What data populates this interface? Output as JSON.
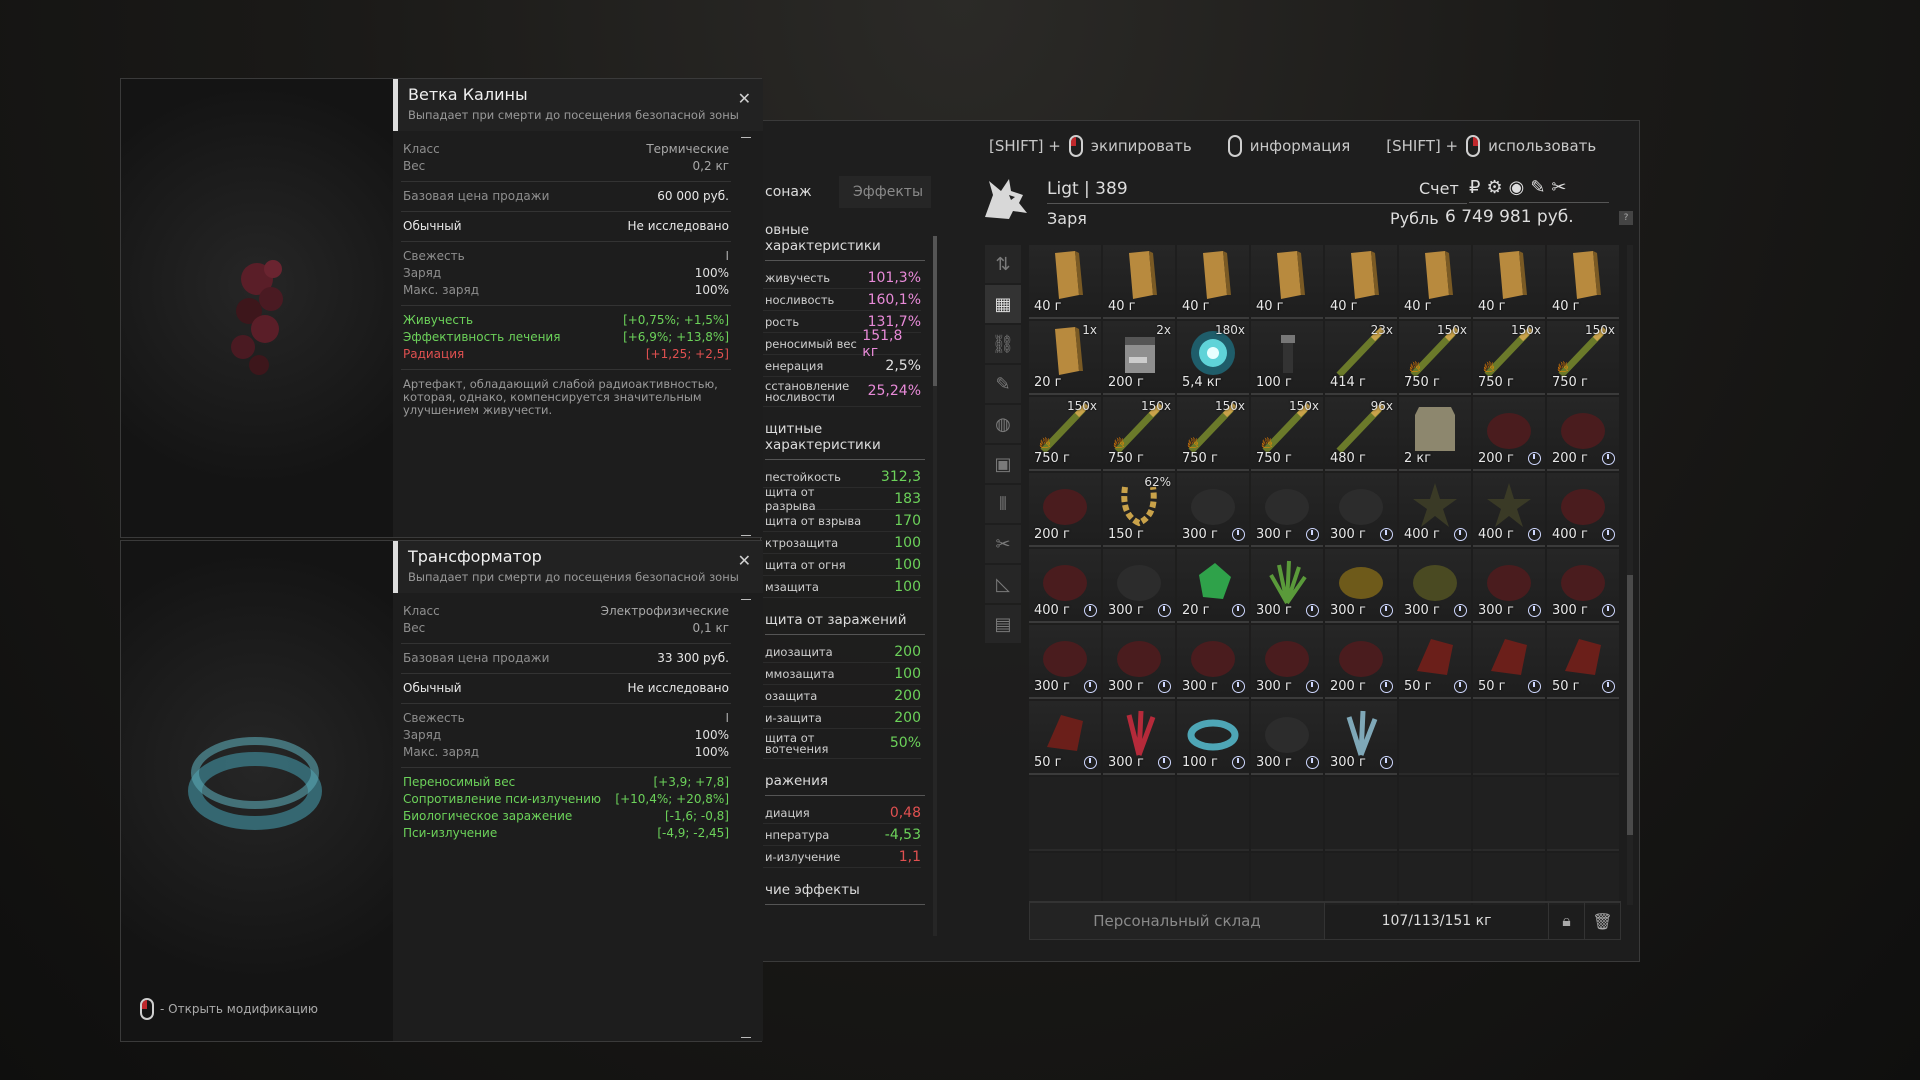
{
  "hints": {
    "equip_prefix": "[SHIFT] +",
    "equip_label": "экипировать",
    "info_label": "информация",
    "use_prefix": "[SHIFT] +",
    "use_label": "использовать"
  },
  "stats": {
    "tab_character": "сонаж",
    "tab_effects": "Эффекты",
    "sections": [
      {
        "title": "овные характеристики",
        "rows": [
          {
            "label": "живучесть",
            "value": "101,3%",
            "color": "pink"
          },
          {
            "label": "носливость",
            "value": "160,1%",
            "color": "pink"
          },
          {
            "label": "рость",
            "value": "131,7%",
            "color": "pink"
          },
          {
            "label": "реносимый вес",
            "value": "151,8 кг",
            "color": "pink"
          },
          {
            "label": "енерация",
            "value": "2,5%",
            "color": "white"
          },
          {
            "label": "сстановление носливости",
            "value": "25,24%",
            "color": "pink",
            "tall": true
          }
        ]
      },
      {
        "title": "щитные характеристики",
        "rows": [
          {
            "label": "пестойкость",
            "value": "312,3",
            "color": "green"
          },
          {
            "label": "щита от разрыва",
            "value": "183",
            "color": "green"
          },
          {
            "label": "щита от взрыва",
            "value": "170",
            "color": "green"
          },
          {
            "label": "ктрозащита",
            "value": "100",
            "color": "green"
          },
          {
            "label": "щита от огня",
            "value": "100",
            "color": "green"
          },
          {
            "label": "мзащита",
            "value": "100",
            "color": "green"
          }
        ]
      },
      {
        "title": "щита от заражений",
        "rows": [
          {
            "label": "диозащита",
            "value": "200",
            "color": "green"
          },
          {
            "label": "ммозащита",
            "value": "100",
            "color": "green"
          },
          {
            "label": "озащита",
            "value": "200",
            "color": "green"
          },
          {
            "label": "и-защита",
            "value": "200",
            "color": "green"
          },
          {
            "label": "щита от вотечения",
            "value": "50%",
            "color": "green",
            "tall": true
          }
        ]
      },
      {
        "title": "ражения",
        "rows": [
          {
            "label": "диация",
            "value": "0,48",
            "color": "red"
          },
          {
            "label": "нпература",
            "value": "-4,53",
            "color": "green"
          },
          {
            "label": "и-излучение",
            "value": "1,1",
            "color": "red"
          }
        ]
      },
      {
        "title": "чие эффекты",
        "rows": []
      }
    ]
  },
  "header": {
    "name_line": "Ligt | 389",
    "faction": "Заря",
    "account_label": "Счет",
    "currency_icons": [
      "₽",
      "⚙",
      "◉",
      "✎",
      "✂"
    ],
    "rub_label": "Рубль",
    "rub_value": "6 749 981 руб.",
    "help": "?"
  },
  "categories": [
    {
      "icon": "sort-icon",
      "glyph": "⇅"
    },
    {
      "icon": "grid-icon",
      "glyph": "▦",
      "active": true
    },
    {
      "icon": "link-icon",
      "glyph": "⛓"
    },
    {
      "icon": "rifle-icon",
      "glyph": "✎"
    },
    {
      "icon": "armor-icon",
      "glyph": "◍"
    },
    {
      "icon": "backpack-icon",
      "glyph": "▣"
    },
    {
      "icon": "ammo-icon",
      "glyph": "⦀"
    },
    {
      "icon": "tools-icon",
      "glyph": "✂"
    },
    {
      "icon": "ruler-icon",
      "glyph": "◺"
    },
    {
      "icon": "box-icon",
      "glyph": "▤"
    }
  ],
  "items": [
    {
      "type": "bar",
      "price": "40 г"
    },
    {
      "type": "bar",
      "price": "40 г"
    },
    {
      "type": "bar",
      "price": "40 г"
    },
    {
      "type": "bar",
      "price": "40 г"
    },
    {
      "type": "bar",
      "price": "40 г"
    },
    {
      "type": "bar",
      "price": "40 г"
    },
    {
      "type": "bar",
      "price": "40 г"
    },
    {
      "type": "bar",
      "price": "40 г"
    },
    {
      "type": "bar",
      "price": "20 г",
      "qty": "1x"
    },
    {
      "type": "bag",
      "price": "200 г",
      "qty": "2x"
    },
    {
      "type": "orb",
      "price": "5,4 кг",
      "qty": "180x"
    },
    {
      "type": "device",
      "price": "100 г"
    },
    {
      "type": "bullet",
      "price": "414 г",
      "qty": "23x"
    },
    {
      "type": "bullet",
      "price": "750 г",
      "qty": "150x",
      "fire": true
    },
    {
      "type": "bullet",
      "price": "750 г",
      "qty": "150x",
      "fire": true
    },
    {
      "type": "bullet",
      "price": "750 г",
      "qty": "150x",
      "fire": true
    },
    {
      "type": "bullet",
      "price": "750 г",
      "qty": "150x",
      "fire": true
    },
    {
      "type": "bullet",
      "price": "750 г",
      "qty": "150x",
      "fire": true
    },
    {
      "type": "bullet",
      "price": "750 г",
      "qty": "150x",
      "fire": true
    },
    {
      "type": "bullet",
      "price": "750 г",
      "qty": "150x",
      "fire": true
    },
    {
      "type": "bullet",
      "price": "480 г",
      "qty": "96x"
    },
    {
      "type": "plate",
      "price": "2 кг"
    },
    {
      "type": "rock-red",
      "price": "200 г",
      "clock": true
    },
    {
      "type": "rock-red",
      "price": "200 г",
      "clock": true
    },
    {
      "type": "rock-red",
      "price": "200 г"
    },
    {
      "type": "necklace",
      "price": "150 г",
      "qty": "62%"
    },
    {
      "type": "rock-dark",
      "price": "300 г",
      "clock": true
    },
    {
      "type": "rock-dark",
      "price": "300 г",
      "clock": true
    },
    {
      "type": "rock-dark",
      "price": "300 г",
      "clock": true
    },
    {
      "type": "star",
      "price": "400 г",
      "clock": true
    },
    {
      "type": "star",
      "price": "400 г",
      "clock": true
    },
    {
      "type": "rock-red",
      "price": "400 г",
      "clock": true
    },
    {
      "type": "rock-red",
      "price": "400 г",
      "clock": true
    },
    {
      "type": "rock-dark",
      "price": "300 г",
      "clock": true
    },
    {
      "type": "crystal-green",
      "price": "20 г",
      "clock": true
    },
    {
      "type": "plant",
      "price": "300 г",
      "clock": true
    },
    {
      "type": "rock-yellow",
      "price": "300 г",
      "clock": true
    },
    {
      "type": "rock-olive",
      "price": "300 г",
      "clock": true
    },
    {
      "type": "rock-red",
      "price": "300 г",
      "clock": true
    },
    {
      "type": "rock-red",
      "price": "300 г",
      "clock": true
    },
    {
      "type": "rock-red",
      "price": "300 г",
      "clock": true
    },
    {
      "type": "rock-red",
      "price": "300 г",
      "clock": true
    },
    {
      "type": "rock-red",
      "price": "300 г",
      "clock": true
    },
    {
      "type": "rock-red",
      "price": "300 г",
      "clock": true
    },
    {
      "type": "rock-red",
      "price": "200 г",
      "clock": true
    },
    {
      "type": "shard-red",
      "price": "50 г",
      "clock": true
    },
    {
      "type": "shard-red",
      "price": "50 г",
      "clock": true
    },
    {
      "type": "shard-red",
      "price": "50 г",
      "clock": true
    },
    {
      "type": "shard-red",
      "price": "50 г",
      "clock": true
    },
    {
      "type": "coral",
      "price": "300 г",
      "clock": true
    },
    {
      "type": "ring",
      "price": "100 г",
      "clock": true
    },
    {
      "type": "rock-dark",
      "price": "300 г",
      "clock": true
    },
    {
      "type": "crystal-blue",
      "price": "300 г",
      "clock": true
    }
  ],
  "grid_total_cells": 72,
  "footer": {
    "storage_label": "Персональный склад",
    "weight": "107/113/151 кг"
  },
  "tooltip1": {
    "name": "Ветка Калины",
    "subtitle": "Выпадает при смерти до посещения безопасной зоны",
    "class_label": "Класс",
    "class_value": "Термические",
    "weight_label": "Вес",
    "weight_value": "0,2 кг",
    "price_label": "Базовая цена продажи",
    "price_value": "60 000 руб.",
    "rarity": "Обычный",
    "research": "Не исследовано",
    "fresh_label": "Свежесть",
    "fresh_value": "I",
    "charge_label": "Заряд",
    "charge_value": "100%",
    "max_label": "Макс. заряд",
    "max_value": "100%",
    "effects": [
      {
        "label": "Живучесть",
        "value": "[+0,75%; +1,5%]",
        "color": "g"
      },
      {
        "label": "Эффективность лечения",
        "value": "[+6,9%; +13,8%]",
        "color": "g"
      },
      {
        "label": "Радиация",
        "value": "[+1,25; +2,5]",
        "color": "r"
      }
    ],
    "description": "Артефакт, обладающий слабой радиоактивностью, которая, однако, компенсируется значительным улучшением живучести."
  },
  "tooltip2": {
    "name": "Трансформатор",
    "subtitle": "Выпадает при смерти до посещения безопасной зоны",
    "class_label": "Класс",
    "class_value": "Электрофизические",
    "weight_label": "Вес",
    "weight_value": "0,1 кг",
    "price_label": "Базовая цена продажи",
    "price_value": "33 300 руб.",
    "rarity": "Обычный",
    "research": "Не исследовано",
    "fresh_label": "Свежесть",
    "fresh_value": "I",
    "charge_label": "Заряд",
    "charge_value": "100%",
    "max_label": "Макс. заряд",
    "max_value": "100%",
    "effects": [
      {
        "label": "Переносимый вес",
        "value": "[+3,9; +7,8]",
        "color": "g"
      },
      {
        "label": "Сопротивление пси-излучению",
        "value": "[+10,4%; +20,8%]",
        "color": "g"
      },
      {
        "label": "Биологическое заражение",
        "value": "[-1,6; -0,8]",
        "color": "g"
      },
      {
        "label": "Пси-излучение",
        "value": "[-4,9; -2,45]",
        "color": "g"
      }
    ]
  },
  "open_mod": "- Открыть модификацию"
}
